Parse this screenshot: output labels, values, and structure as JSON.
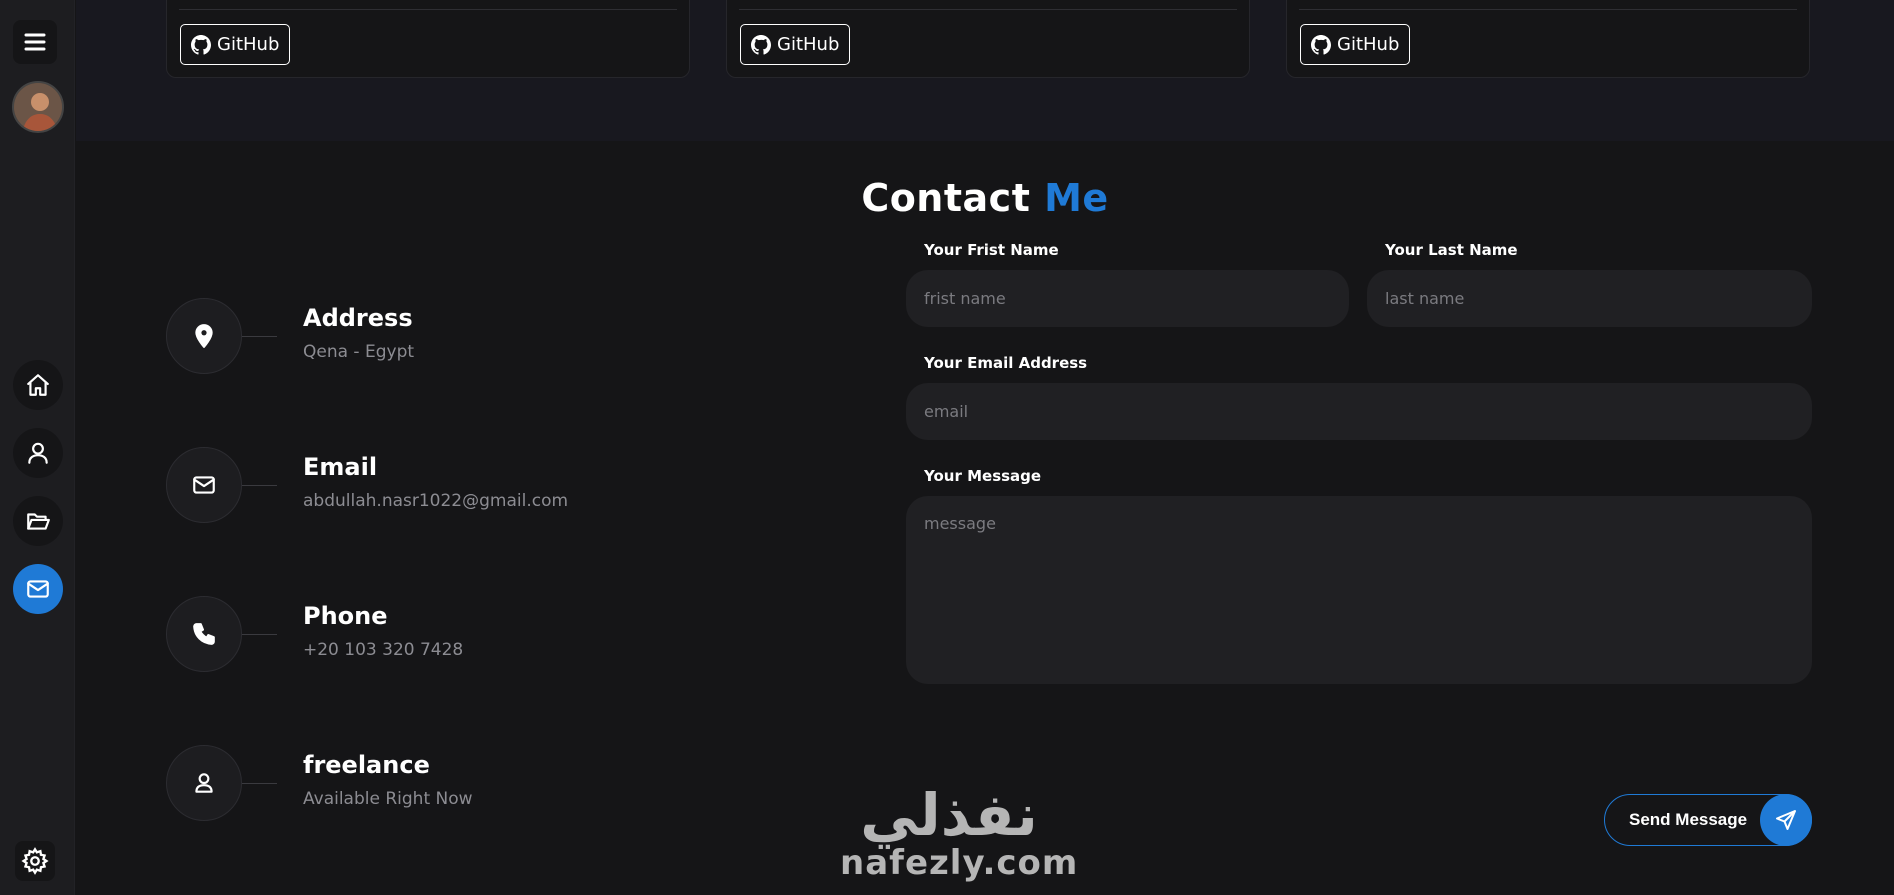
{
  "sidebar": {
    "menu_icon": "hamburger-menu-icon",
    "avatar_alt": "profile photo",
    "nav": [
      {
        "name": "home",
        "icon": "home-icon",
        "active": false
      },
      {
        "name": "about",
        "icon": "user-icon",
        "active": false
      },
      {
        "name": "portfolio",
        "icon": "folder-icon",
        "active": false
      },
      {
        "name": "contact",
        "icon": "mail-icon",
        "active": true
      }
    ],
    "settings_icon": "gear-icon"
  },
  "projects": {
    "cards": [
      {
        "github_label": "GitHub"
      },
      {
        "github_label": "GitHub"
      },
      {
        "github_label": "GitHub"
      }
    ]
  },
  "contact": {
    "title_main": "Contact",
    "title_accent": "Me",
    "info": [
      {
        "icon": "location-pin-icon",
        "title": "Address",
        "value": "Qena - Egypt"
      },
      {
        "icon": "mail-icon",
        "title": "Email",
        "value": "abdullah.nasr1022@gmail.com"
      },
      {
        "icon": "phone-icon",
        "title": "Phone",
        "value": "+20 103 320 7428"
      },
      {
        "icon": "user-icon",
        "title": "freelance",
        "value": "Available Right Now"
      }
    ],
    "form": {
      "first_name_label": "Your Frist Name",
      "first_name_placeholder": "frist name",
      "last_name_label": "Your Last Name",
      "last_name_placeholder": "last name",
      "email_label": "Your Email Address",
      "email_placeholder": "email",
      "message_label": "Your Message",
      "message_placeholder": "message",
      "send_label": "Send Message",
      "send_icon": "paper-plane-icon"
    }
  },
  "watermark": {
    "arabic": "نفذلي",
    "latin": "nafezly.com"
  },
  "colors": {
    "accent": "#1f7ad6",
    "background": "#151517",
    "sidebar": "#1d1d20"
  }
}
